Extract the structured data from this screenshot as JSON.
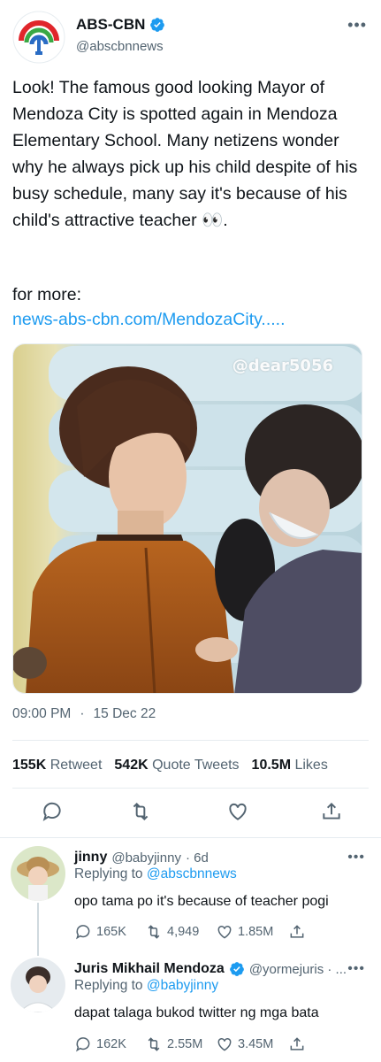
{
  "account": {
    "name": "ABS-CBN",
    "handle": "@abscbnnews"
  },
  "tweet": {
    "text": "Look! The famous good looking Mayor of Mendoza City is spotted again in Mendoza Elementary School. Many netizens wonder why he always pick up his child despite of his busy schedule, many say it's because of his child's attractive teacher 👀.",
    "for_more": "for more:",
    "link": "news-abs-cbn.com/MendozaCity.....",
    "watermark": "@dear5056",
    "time": "09:00 PM",
    "separator": "·",
    "date": "15 Dec 22"
  },
  "stats": {
    "retweets_value": "155K",
    "retweets_label": "Retweet",
    "quotes_value": "542K",
    "quotes_label": "Quote Tweets",
    "likes_value": "10.5M",
    "likes_label": "Likes"
  },
  "action_icons": [
    "reply-icon",
    "retweet-icon",
    "like-icon",
    "share-icon"
  ],
  "replies": [
    {
      "name": "jinny",
      "handle": "@babyjinny",
      "time": "· 6d",
      "replying_prefix": "Replying to",
      "replying_to": "@abscbnnews",
      "text": "opo tama po it's because of teacher pogi",
      "replies": "165K",
      "retweets": "4,949",
      "likes": "1.85M"
    },
    {
      "name": "Juris Mikhail Mendoza",
      "handle": "@yormejuris · ...",
      "replying_prefix": "Replying to",
      "replying_to": "@babyjinny",
      "text": "dapat talaga bukod twitter ng mga bata",
      "replies": "162K",
      "retweets": "2.55M",
      "likes": "3.45M"
    }
  ],
  "colors": {
    "accent": "#1d9bf0",
    "muted": "#536471",
    "border": "#e6ecf0"
  }
}
